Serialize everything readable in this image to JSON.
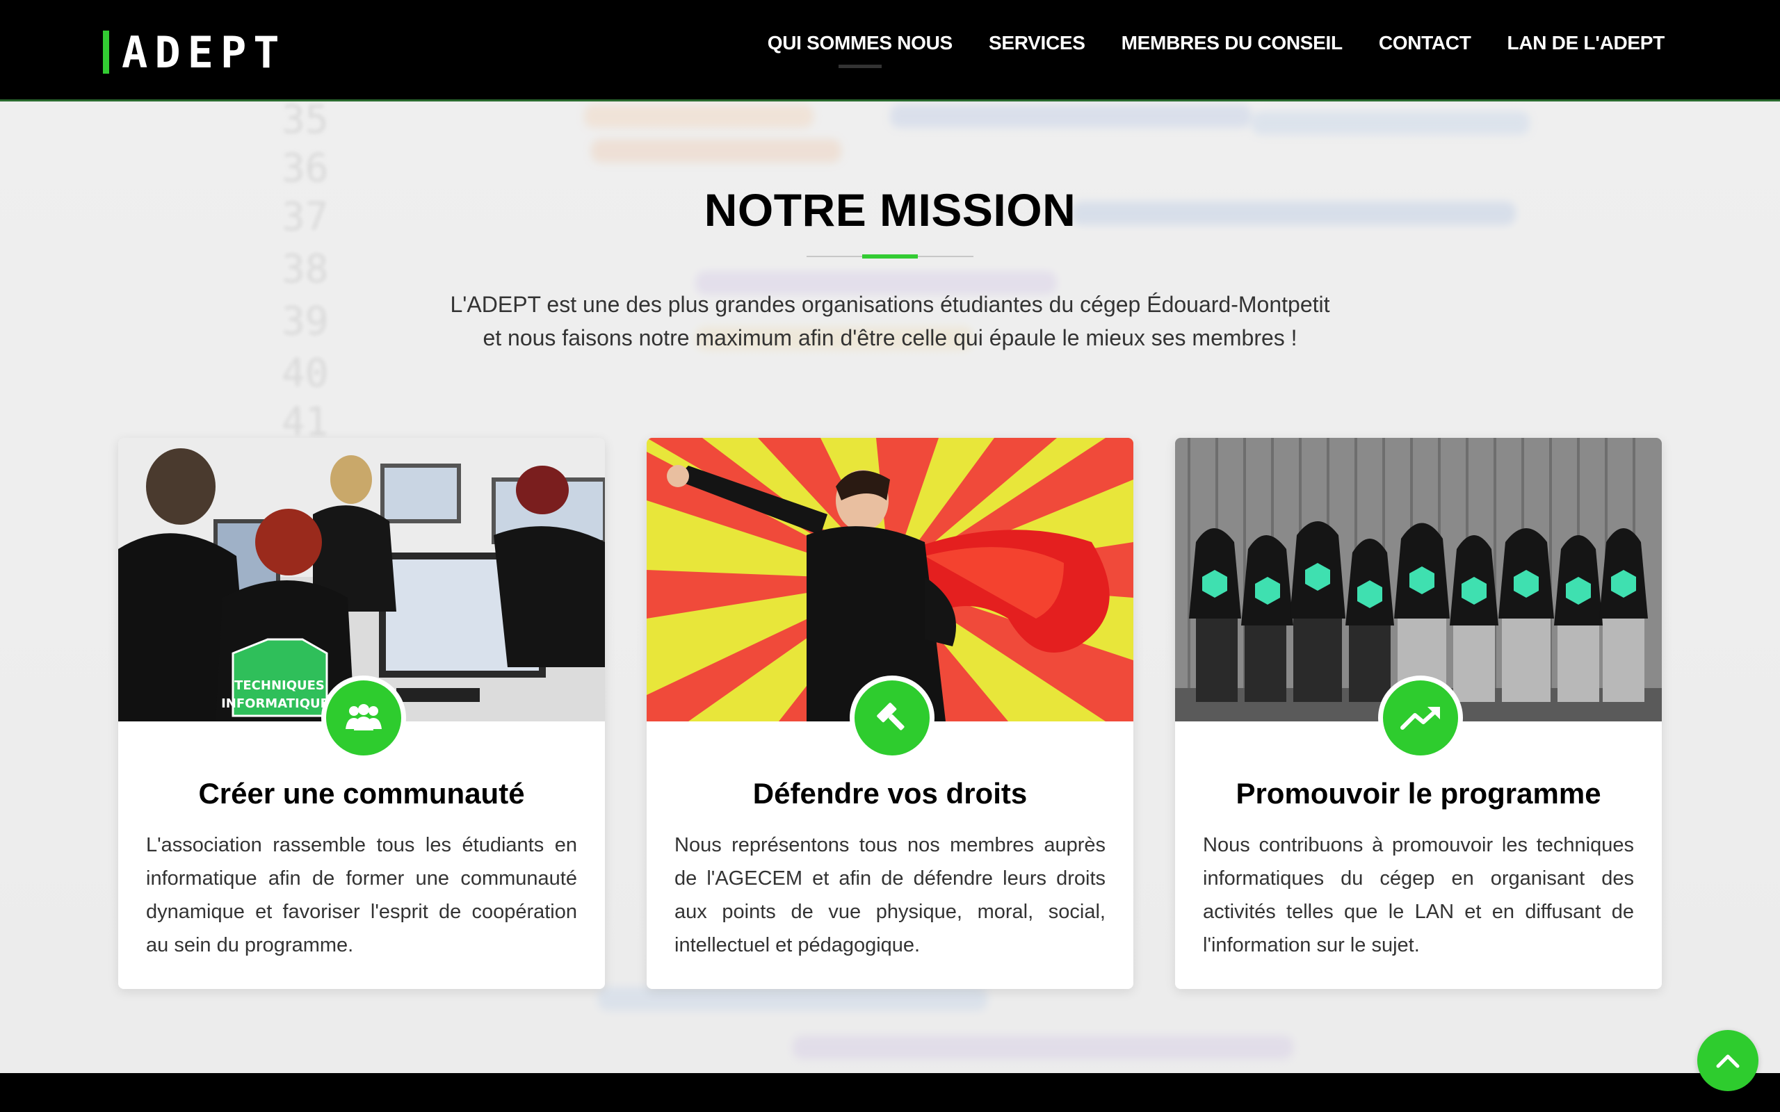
{
  "brand": {
    "logo_text": "ADEPT",
    "accent": "#33cc33",
    "dark": "#000000"
  },
  "nav": {
    "items": [
      {
        "label": "QUI SOMMES NOUS",
        "active": true
      },
      {
        "label": "SERVICES"
      },
      {
        "label": "MEMBRES DU CONSEIL"
      },
      {
        "label": "CONTACT"
      },
      {
        "label": "LAN DE L'ADEPT"
      }
    ]
  },
  "hero": {
    "title": "NOTRE MISSION",
    "intro_line1": "L'ADEPT est une des plus grandes organisations étudiantes du cégep Édouard-Montpetit",
    "intro_line2": "et nous faisons notre maximum afin d'être celle qui épaule le mieux ses membres !"
  },
  "cards": [
    {
      "title": "Créer une communauté",
      "icon": "users-icon",
      "photo": "students-at-computers-photo",
      "photo_badge_line1": "TECHNIQUES",
      "photo_badge_line2": "INFORMATIQUES",
      "text": "L'association rassemble tous les étudiants en informatique afin de former une communauté dynamique et favoriser l'esprit de coopération au sein du programme."
    },
    {
      "title": "Défendre vos droits",
      "icon": "gavel-icon",
      "photo": "superhero-student-photo",
      "text": "Nous représentons tous nos membres auprès de l'AGECEM et afin de défendre leurs droits aux points de vue physique, moral, social, intellectuel et pédagogique."
    },
    {
      "title": "Promouvoir le programme",
      "icon": "trending-up-icon",
      "photo": "hoodie-group-photo",
      "text": "Nous contribuons à promouvoir les techniques informatiques du cégep en organisant des activités telles que le LAN et en diffusant de l'information sur le sujet."
    }
  ],
  "scroll_top": {
    "icon": "chevron-up-icon"
  }
}
